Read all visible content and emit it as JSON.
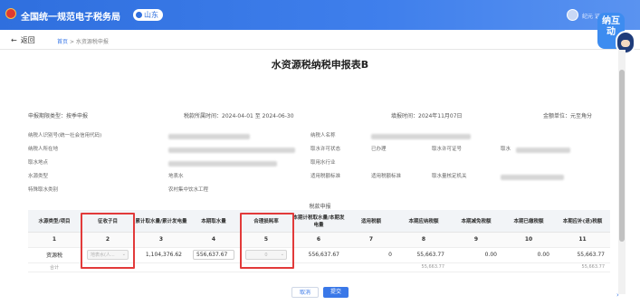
{
  "header": {
    "brand": "全国统一规范电子税务局",
    "region": "山东",
    "user": "纪元 证"
  },
  "nav": {
    "back_label": "返回",
    "breadcrumb_home": "首页",
    "breadcrumb_sep": ">",
    "breadcrumb_current": "水资源税申报"
  },
  "assistant": {
    "label": "纳互动"
  },
  "form": {
    "title": "水资源税纳税申报表B",
    "period_type_label": "申报期限类型：按季申报",
    "tax_period_label": "税款所属时间：2024-04-01 至 2024-06-30",
    "fill_date_label": "填报时间：2024年11月07日",
    "unit_label": "金额单位：元至角分"
  },
  "info": {
    "taxpayer_id_label": "纳税人识别号(统一社会信用代码)",
    "taxpayer_name_label": "纳税人名称",
    "taxpayer_location_label": "纳税人所在地",
    "permit_status_label": "取水许可状态",
    "permit_status_value": "已办理",
    "permit_no_label": "取水许可证号",
    "permit_no_prefix": "取水",
    "intake_location_label": "取水地点",
    "industry_label": "取用水行业",
    "source_type_label": "水源类型",
    "source_type_value": "地表水",
    "standard_label": "适用税额标准",
    "standard_value": "适用税额标准",
    "authority_label": "取水量核定机关",
    "special_label": "特殊取水类别",
    "special_value": "农村集中饮水工程"
  },
  "table": {
    "section_title": "税款申报",
    "headers": [
      "水源类型/项目",
      "征收子目",
      "累计取水量/累计发电量",
      "本期取水量",
      "合理损耗率",
      "本期计税取水量/本期发电量",
      "适用税额",
      "本期应纳税额",
      "本期减免税额",
      "本期已缴税额",
      "本期应补(退)税额"
    ],
    "index": [
      "1",
      "2",
      "3",
      "4",
      "5",
      "6",
      "7",
      "8",
      "9",
      "10",
      "11"
    ],
    "row": {
      "type": "资源税",
      "subitem": "地表水(人...",
      "cumulative": "1,104,376.62",
      "current": "556,637.67",
      "loss_rate": "0",
      "taxable": "556,637.67",
      "rate": "0",
      "payable": "55,663.77",
      "reduction": "0.00",
      "paid": "0.00",
      "due": "55,663.77"
    },
    "sum_row": {
      "label": "合计",
      "payable": "55,663.77",
      "due": "55,663.77"
    }
  },
  "buttons": {
    "cancel": "取消",
    "submit": "提交"
  }
}
